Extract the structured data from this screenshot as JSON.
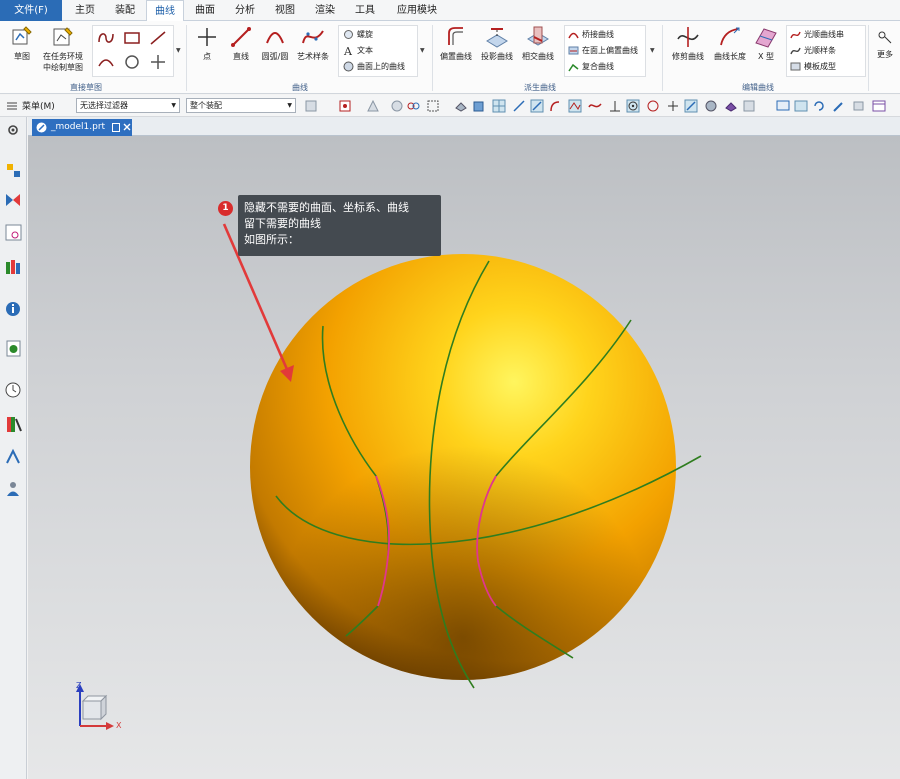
{
  "menu": {
    "file": "文件(F)",
    "tabs": [
      "主页",
      "装配",
      "曲线",
      "曲面",
      "分析",
      "视图",
      "渲染",
      "工具",
      "应用模块"
    ],
    "active_tab": "曲线"
  },
  "ribbon": {
    "sketch": "草图",
    "task_env_sketch_line1": "在任务环境",
    "task_env_sketch_line2": "中绘制草图",
    "direct_sketch_label": "直接草图",
    "point": "点",
    "line": "直线",
    "arc_circle": "圆弧/圆",
    "art_spline": "艺术样条",
    "helix": "螺旋",
    "text": "文本",
    "curve_on_surface": "曲面上的曲线",
    "curve_group_label": "曲线",
    "offset_curve": "偏置曲线",
    "project_curve": "投影曲线",
    "intersect_curve": "相交曲线",
    "bridge_curve": "桥接曲线",
    "offset_in_face": "在面上偏置曲线",
    "composite_curve": "复合曲线",
    "derived_label": "派生曲线",
    "trim_curve": "修剪曲线",
    "curve_length": "曲线长度",
    "x_form": "X 型",
    "smooth_curve_string": "光顺曲线串",
    "smooth_spline": "光顺样条",
    "template_shape": "模板成型",
    "edit_label": "编辑曲线",
    "more": "更多"
  },
  "selbar": {
    "menu": "菜单(M)",
    "filter": "无选择过滤器",
    "scope": "整个装配"
  },
  "document": {
    "tab_name": "_model1.prt"
  },
  "callout": {
    "number": "1",
    "line1": "隐藏不需要的曲面、坐标系、曲线",
    "line2": "留下需要的曲线",
    "line3": "如图所示："
  },
  "triad": {
    "x": "X",
    "z": "Z"
  },
  "colors": {
    "ball": "#f3a100",
    "seam": "#2f7d1f",
    "highlight": "#e0368e",
    "arrow": "#e23a3a",
    "accent": "#2b6cb6"
  }
}
